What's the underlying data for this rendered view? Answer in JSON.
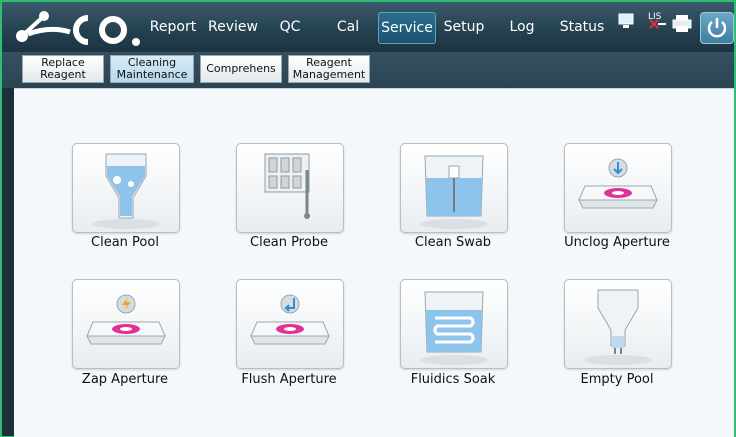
{
  "nav": {
    "items": [
      {
        "label": "Report"
      },
      {
        "label": "Review"
      },
      {
        "label": "QC"
      },
      {
        "label": "Cal"
      },
      {
        "label": "Service",
        "active": true
      },
      {
        "label": "Setup"
      },
      {
        "label": "Log"
      },
      {
        "label": "Status"
      }
    ],
    "lis_label": "LIS"
  },
  "subtabs": [
    {
      "line1": "Replace",
      "line2": "Reagent"
    },
    {
      "line1": "Cleaning",
      "line2": "Maintenance",
      "active": true
    },
    {
      "line1": "Comprehens",
      "line2": ""
    },
    {
      "line1": "Reagent",
      "line2": "Management"
    }
  ],
  "tiles": [
    {
      "label": "Clean Pool",
      "icon": "funnel-pool-icon"
    },
    {
      "label": "Clean Probe",
      "icon": "probe-rack-icon"
    },
    {
      "label": "Clean Swab",
      "icon": "beaker-swab-icon"
    },
    {
      "label": "Unclog Aperture",
      "icon": "aperture-down-arrow-icon"
    },
    {
      "label": "Zap Aperture",
      "icon": "aperture-lightning-icon"
    },
    {
      "label": "Flush Aperture",
      "icon": "aperture-flush-icon"
    },
    {
      "label": "Fluidics Soak",
      "icon": "beaker-coil-icon"
    },
    {
      "label": "Empty Pool",
      "icon": "empty-funnel-icon"
    }
  ],
  "colors": {
    "accent": "#1c5270",
    "magenta": "#e0319a",
    "liquid": "#8ec4ec"
  }
}
